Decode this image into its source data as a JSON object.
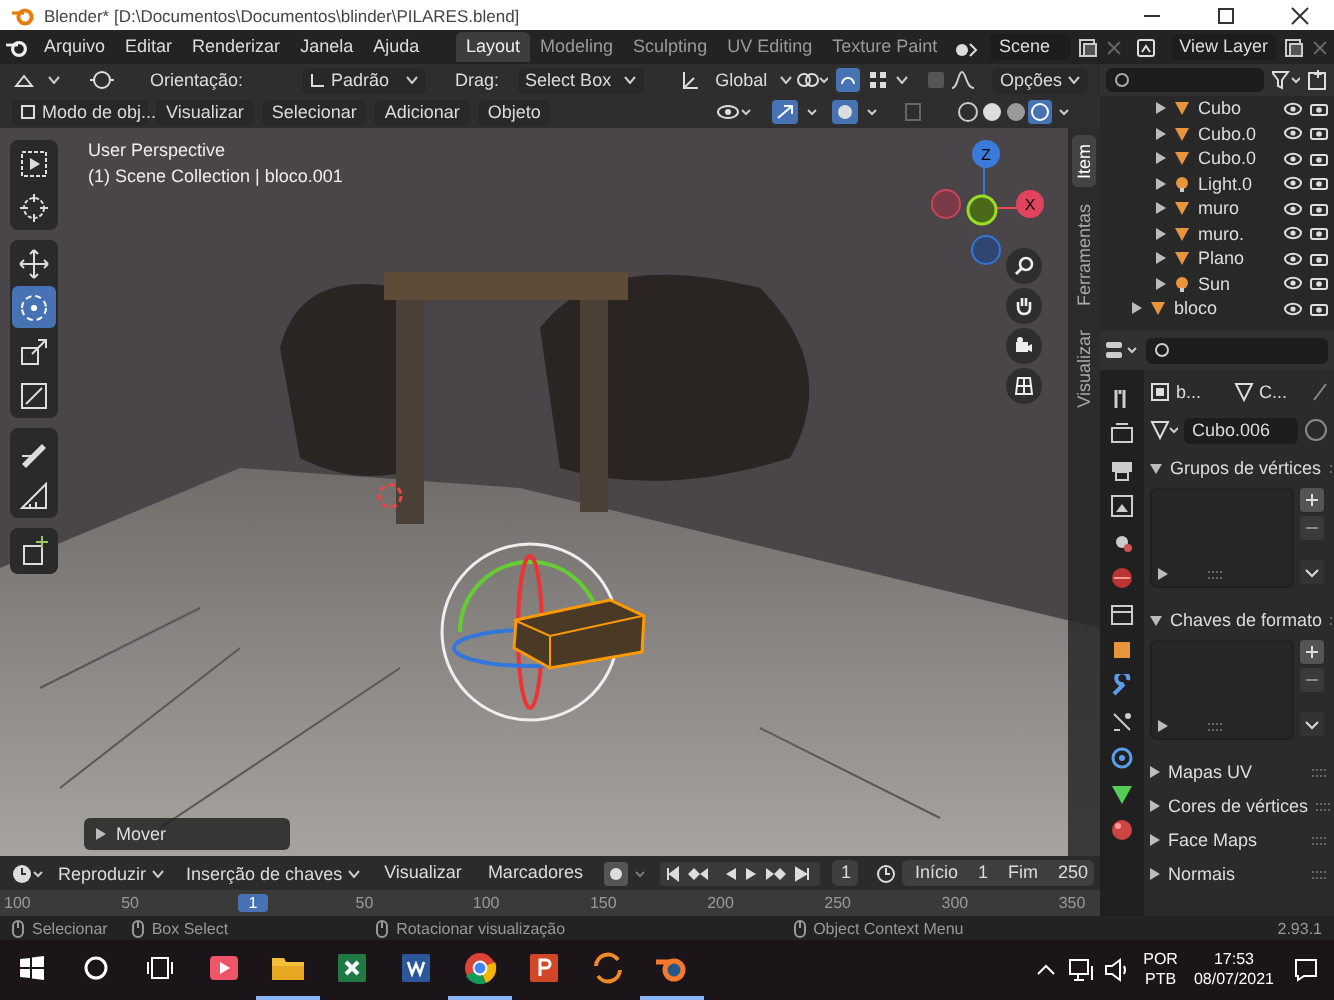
{
  "window": {
    "title": "Blender* [D:\\Documentos\\Documentos\\blinder\\PILARES.blend]"
  },
  "menu": [
    "Arquivo",
    "Editar",
    "Renderizar",
    "Janela",
    "Ajuda"
  ],
  "workspaces": [
    {
      "label": "Layout",
      "selected": true
    },
    {
      "label": "Modeling",
      "selected": false
    },
    {
      "label": "Sculpting",
      "selected": false
    },
    {
      "label": "UV Editing",
      "selected": false
    },
    {
      "label": "Texture Paint",
      "selected": false
    }
  ],
  "scene": "Scene",
  "view_layer": "View Layer",
  "viewport": {
    "header": {
      "orientation_label": "Orientação:",
      "orientation": "Padrão",
      "drag_label": "Drag:",
      "drag": "Select Box",
      "transform": "Global",
      "options": "Opções"
    },
    "mode": "Modo de obj...",
    "menus": [
      "Visualizar",
      "Selecionar",
      "Adicionar",
      "Objeto"
    ],
    "perspective": "User Perspective",
    "collection": "(1) Scene Collection | bloco.001",
    "axis_labels": [
      "Z",
      "X"
    ],
    "last_operator": "Mover",
    "tools": [
      {
        "kind": "select",
        "selected": false
      },
      {
        "kind": "cursor",
        "selected": false
      },
      {
        "kind": "move",
        "selected": false
      },
      {
        "kind": "rotate",
        "selected": true
      },
      {
        "kind": "scale",
        "selected": false
      },
      {
        "kind": "transform",
        "selected": false
      },
      {
        "kind": "annotate",
        "selected": false
      },
      {
        "kind": "measure",
        "selected": false
      },
      {
        "kind": "add-cube",
        "selected": false
      }
    ],
    "side_tabs": [
      {
        "label": "Item",
        "selected": true
      },
      {
        "label": "Ferramentas",
        "selected": false
      },
      {
        "label": "Visualizar",
        "selected": false
      }
    ]
  },
  "outliner": {
    "nested_items": [
      {
        "name": "Cubo",
        "kind": "mesh"
      },
      {
        "name": "Cubo.0",
        "kind": "mesh"
      },
      {
        "name": "Cubo.0",
        "kind": "mesh"
      },
      {
        "name": "Light.0",
        "kind": "light"
      },
      {
        "name": "muro",
        "kind": "mesh"
      },
      {
        "name": "muro.",
        "kind": "mesh"
      },
      {
        "name": "Plano",
        "kind": "mesh"
      },
      {
        "name": "Sun",
        "kind": "light"
      }
    ],
    "items": [
      {
        "name": "bloco",
        "kind": "mesh"
      }
    ]
  },
  "properties": {
    "breadcrumb": [
      "b...",
      "C..."
    ],
    "datablock": "Cubo.006",
    "panels": [
      {
        "title": "Grupos de vértices",
        "expanded": true
      },
      {
        "title": "Chaves de formato",
        "expanded": true
      },
      {
        "title": "Mapas UV",
        "expanded": false
      },
      {
        "title": "Cores de vértices",
        "expanded": false
      },
      {
        "title": "Face Maps",
        "expanded": false
      },
      {
        "title": "Normais",
        "expanded": false
      }
    ]
  },
  "timeline": {
    "menus": [
      {
        "label": "Reproduzir",
        "kind": "dropdown"
      },
      {
        "label": "Inserção de chaves",
        "kind": "dropdown"
      },
      {
        "label": "Visualizar",
        "kind": "plain"
      },
      {
        "label": "Marcadores",
        "kind": "plain"
      }
    ],
    "frame": "1",
    "start_label": "Início",
    "start": "1",
    "end_label": "Fim",
    "end": "250",
    "ruler": [
      {
        "label": "100",
        "kind": "tick"
      },
      {
        "label": "50",
        "kind": "tick"
      },
      {
        "label": "1",
        "kind": "current"
      },
      {
        "label": "50",
        "kind": "tick"
      },
      {
        "label": "100",
        "kind": "tick"
      },
      {
        "label": "150",
        "kind": "tick"
      },
      {
        "label": "200",
        "kind": "tick"
      },
      {
        "label": "250",
        "kind": "tick"
      },
      {
        "label": "300",
        "kind": "tick"
      },
      {
        "label": "350",
        "kind": "tick"
      }
    ]
  },
  "status_bar": {
    "hints": [
      "Selecionar",
      "Box Select",
      "Rotacionar visualização",
      "Object Context Menu"
    ],
    "version": "2.93.1"
  },
  "taskbar": {
    "apps": [
      {
        "kind": "media",
        "running": false
      },
      {
        "kind": "folder",
        "running": true
      },
      {
        "kind": "excel",
        "running": false
      },
      {
        "kind": "word",
        "running": false
      },
      {
        "kind": "chrome",
        "running": true
      },
      {
        "kind": "powerpoint",
        "running": false
      },
      {
        "kind": "sync",
        "running": false
      },
      {
        "kind": "blender",
        "running": true
      }
    ],
    "language": "POR",
    "layout": "PTB",
    "time": "17:53",
    "date": "08/07/2021"
  }
}
